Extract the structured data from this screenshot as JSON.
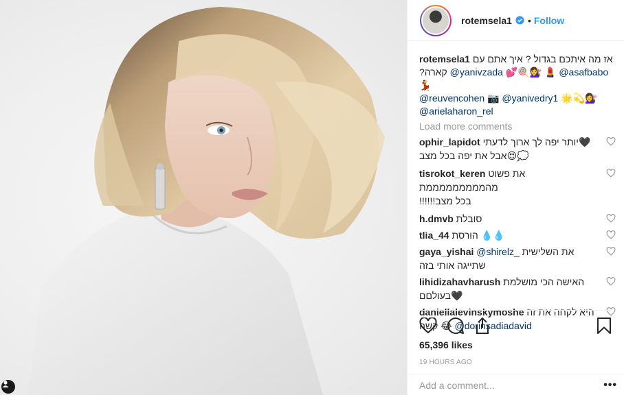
{
  "header": {
    "username": "rotemsela1",
    "separator": "•",
    "follow_label": "Follow"
  },
  "caption": {
    "username": "rotemsela1",
    "line1": "אז מה איתכם בגדול ? איך אתם עם",
    "line2_prefix": "?קארה",
    "mention1": "@yanivzada",
    "mention1_suffix": "💕🍭💇‍♀️",
    "mention2_prefix": "💄",
    "mention2": "@asafbabo",
    "mention2_suffix": "💃",
    "mention3": "@reuvencohen",
    "mention3_suffix": "📷",
    "mention4": "@yanivedry1",
    "mention4_suffix": "🌟💫💇‍♀️",
    "mention5": "@arielaharon_rel"
  },
  "load_more": "Load more comments",
  "comments": [
    {
      "user": "ophir_lapidot",
      "text": "יותר יפה לך ארוך לדעתי🖤",
      "text2": "אבל את יפה בכל מצב😍💭"
    },
    {
      "user": "tisrokot_keren",
      "text": "את פשוט מהמממממממממת",
      "text2": "!!!!!!בכל מצב"
    },
    {
      "user": "h.dmvb",
      "text": "סובלת"
    },
    {
      "user": "tlia_44",
      "text": "הורסת 💧💧"
    },
    {
      "user": "gaya_yishai",
      "mention": "@shirelz_",
      "text": "את השלישית",
      "text2": "שתייגה אותי בזה"
    },
    {
      "user": "lihidizahavharush",
      "text": "האישה הכי מושלמת",
      "text2": "בעולםם🖤"
    },
    {
      "user": "daniellalevinskymoshe",
      "text": "היא לקחה את זה",
      "text2_prefix": "קשה 😂",
      "mention": "@dorinsadiadavid"
    }
  ],
  "likes": "65,396 likes",
  "time": "19 HOURS AGO",
  "add_comment_placeholder": "Add a comment...",
  "more_label": "•••",
  "icons": [
    "heart-icon",
    "comment-icon",
    "share-icon",
    "bookmark-icon",
    "verified-icon",
    "tag-person-icon"
  ],
  "colors": {
    "link": "#3897f0",
    "mention": "#003569",
    "muted": "#999999",
    "verified": "#3897f0"
  }
}
